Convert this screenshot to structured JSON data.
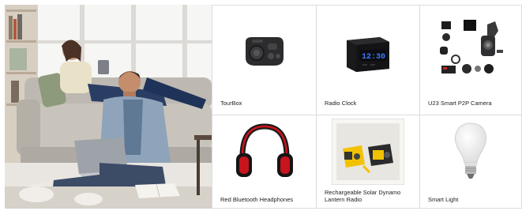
{
  "products": [
    {
      "name": "TourBox",
      "icon": "tourbox-controller-icon"
    },
    {
      "name": "Radio Clock",
      "icon": "radio-clock-icon"
    },
    {
      "name": "U23 Smart P2P Camera",
      "icon": "spy-camera-kit-icon"
    },
    {
      "name": "Red Bluetooth Headphones",
      "icon": "headphones-icon"
    },
    {
      "name": "Rechargeable Solar Dynamo Lantern Radio",
      "icon": "lantern-radio-icon"
    },
    {
      "name": "Smart Light",
      "icon": "light-bulb-icon"
    }
  ],
  "colors": {
    "border": "#dcdcdc",
    "clock_display": "#3a7bff",
    "headphone_red": "#c8141c",
    "lantern_yellow": "#f2c200"
  }
}
